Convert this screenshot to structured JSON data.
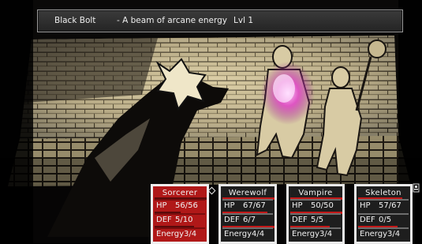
{
  "ability_bar": {
    "name": "Black Bolt",
    "description": "- A beam of arcane energy",
    "level": "Lvl 1"
  },
  "party": [
    {
      "name": "Sorcerer",
      "hp_label": "HP",
      "hp": "56/56",
      "hp_fraction": 1.0,
      "def_label": "DEF",
      "def": "5/10",
      "def_fraction": 0.5,
      "energy_label": "Energy",
      "energy": "3/4",
      "energy_fraction": 0.75,
      "active": true
    },
    {
      "name": "Werewolf",
      "hp_label": "HP",
      "hp": "67/67",
      "hp_fraction": 1.0,
      "def_label": "DEF",
      "def": "6/7",
      "def_fraction": 0.86,
      "energy_label": "Energy",
      "energy": "4/4",
      "energy_fraction": 1.0,
      "active": false
    },
    {
      "name": "Vampire",
      "hp_label": "HP",
      "hp": "50/50",
      "hp_fraction": 1.0,
      "def_label": "DEF",
      "def": "5/5",
      "def_fraction": 1.0,
      "energy_label": "Energy",
      "energy": "3/4",
      "energy_fraction": 0.75,
      "active": false
    },
    {
      "name": "Skeleton",
      "hp_label": "HP",
      "hp": "57/67",
      "hp_fraction": 0.85,
      "def_label": "DEF",
      "def": "0/5",
      "def_fraction": 0.0,
      "energy_label": "Energy",
      "energy": "3/4",
      "energy_fraction": 0.75,
      "active": false
    }
  ],
  "colors": {
    "active_card": "#b01818",
    "bar": "#c41919",
    "spell_glow": "#e040c8"
  },
  "icons": {
    "turn_marker": "diamond-icon",
    "side_icon": "skull-icon"
  }
}
